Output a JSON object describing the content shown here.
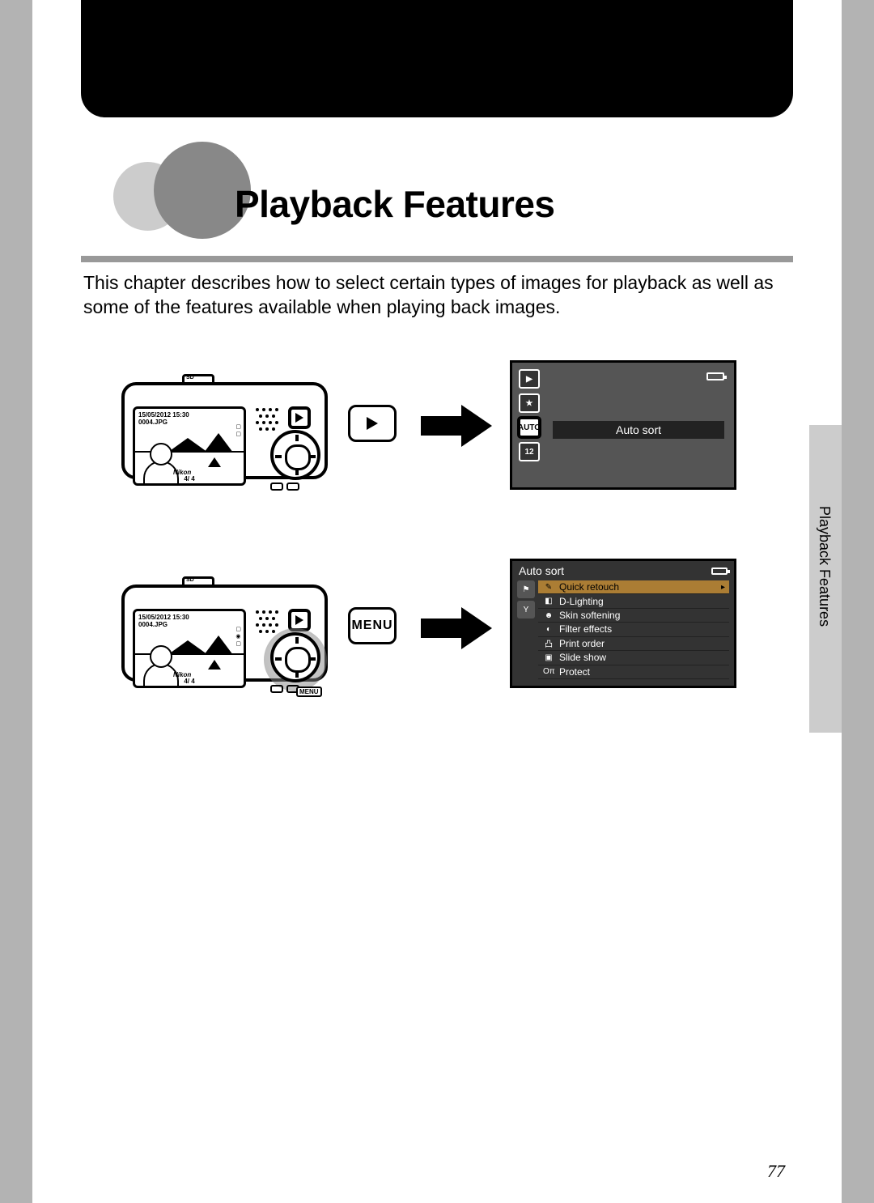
{
  "title": "Playback Features",
  "intro": "This chapter describes how to select certain types of images for playback as well as some of the features available when playing back images.",
  "camera": {
    "date": "15/05/2012 15:30",
    "file": "0004.JPG",
    "counter": "4/    4",
    "brand": "Nikon",
    "sd": "SD"
  },
  "buttons": {
    "menu": "MENU"
  },
  "screen1": {
    "selected_label": "Auto sort",
    "icons": {
      "play": "▶",
      "star": "★",
      "auto": "AUTO",
      "date": "12"
    }
  },
  "screen2": {
    "title": "Auto sort",
    "items": [
      {
        "icon": "✎",
        "label": "Quick retouch",
        "highlight": true
      },
      {
        "icon": "◧",
        "label": "D-Lighting"
      },
      {
        "icon": "☻",
        "label": "Skin softening"
      },
      {
        "icon": "◐",
        "label": "Filter effects"
      },
      {
        "icon": "凸",
        "label": "Print order"
      },
      {
        "icon": "▣",
        "label": "Slide show"
      },
      {
        "icon": "Oπ",
        "label": "Protect"
      }
    ]
  },
  "side_tab": "Playback Features",
  "page_number": "77"
}
